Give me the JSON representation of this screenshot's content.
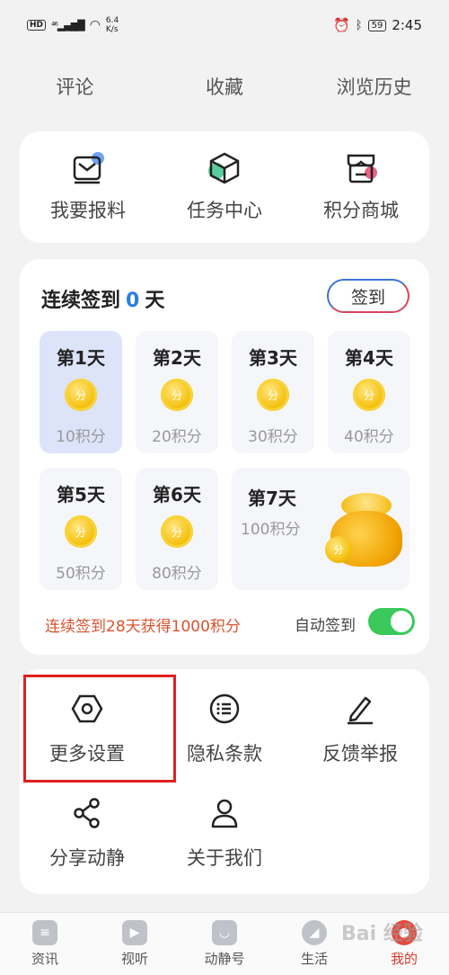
{
  "status_bar": {
    "hd": "HD",
    "network": "⁴⁶",
    "net_speed_value": "6.4",
    "net_speed_unit": "K/s",
    "battery": "59",
    "time": "2:45"
  },
  "top_tabs": [
    "评论",
    "收藏",
    "浏览历史"
  ],
  "services": [
    {
      "label": "我要报料",
      "icon": "mail-icon",
      "accent": "#4a8cf0"
    },
    {
      "label": "任务中心",
      "icon": "cube-icon",
      "accent": "#3cc48c"
    },
    {
      "label": "积分商城",
      "icon": "store-icon",
      "accent": "#e8476f"
    }
  ],
  "checkin": {
    "title_prefix": "连续签到",
    "count": "0",
    "title_suffix": "天",
    "button_label": "签到",
    "coin_label": "分",
    "days": [
      {
        "label": "第1天",
        "points": "10积分",
        "active": true
      },
      {
        "label": "第2天",
        "points": "20积分",
        "active": false
      },
      {
        "label": "第3天",
        "points": "30积分",
        "active": false
      },
      {
        "label": "第4天",
        "points": "40积分",
        "active": false
      },
      {
        "label": "第5天",
        "points": "50积分",
        "active": false
      },
      {
        "label": "第6天",
        "points": "80积分",
        "active": false
      }
    ],
    "day7": {
      "label": "第7天",
      "points": "100积分"
    },
    "bonus_text": "连续签到28天获得1000积分",
    "auto_label": "自动签到",
    "auto_enabled": true
  },
  "settings": [
    {
      "label": "更多设置",
      "icon": "hexagon-settings-icon"
    },
    {
      "label": "隐私条款",
      "icon": "list-icon"
    },
    {
      "label": "反馈举报",
      "icon": "pen-icon"
    },
    {
      "label": "分享动静",
      "icon": "share-icon"
    },
    {
      "label": "关于我们",
      "icon": "user-icon"
    }
  ],
  "bottom_nav": [
    {
      "label": "资讯",
      "icon": "news-icon",
      "active": false
    },
    {
      "label": "视听",
      "icon": "play-icon",
      "active": false
    },
    {
      "label": "动静号",
      "icon": "chat-icon",
      "active": false
    },
    {
      "label": "生活",
      "icon": "compass-icon",
      "active": false
    },
    {
      "label": "我的",
      "icon": "profile-icon",
      "active": true
    }
  ],
  "watermark": "Bai 经验",
  "colors": {
    "accent_blue": "#2a7fe0",
    "accent_red": "#d9532f",
    "toggle_green": "#3ac95a",
    "highlight_red": "#e02020"
  }
}
